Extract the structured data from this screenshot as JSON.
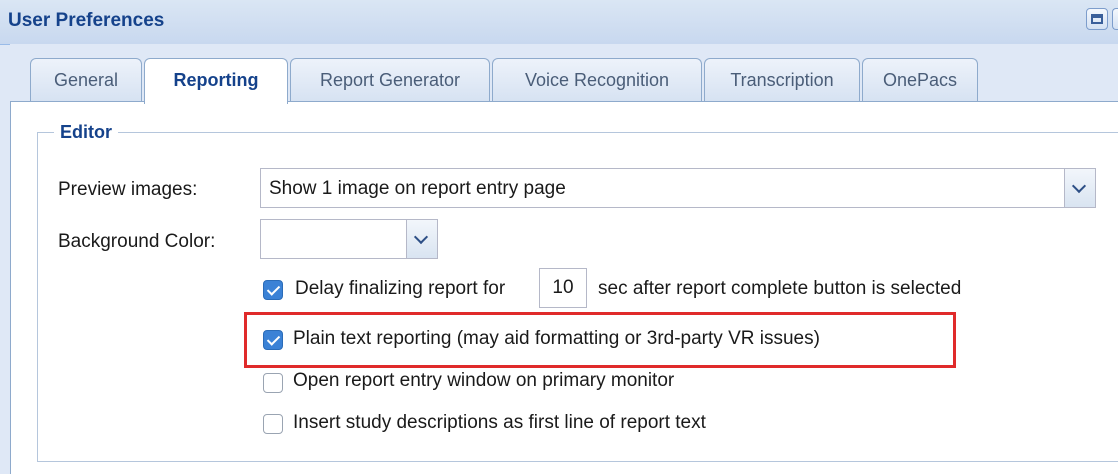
{
  "window": {
    "title": "User Preferences"
  },
  "tabs": [
    {
      "label": "General",
      "active": false
    },
    {
      "label": "Reporting",
      "active": true
    },
    {
      "label": "Report Generator",
      "active": false
    },
    {
      "label": "Voice Recognition",
      "active": false
    },
    {
      "label": "Transcription",
      "active": false
    },
    {
      "label": "OnePacs",
      "active": false
    }
  ],
  "editor": {
    "legend": "Editor",
    "preview_images": {
      "label": "Preview images:",
      "value": "Show 1 image on report entry page",
      "icon": "chevron-down-icon"
    },
    "background_color": {
      "label": "Background Color:",
      "value": "",
      "icon": "chevron-down-icon"
    },
    "delay": {
      "checked": true,
      "label_before": "Delay finalizing report for",
      "seconds": "10",
      "label_after": "sec after report complete button is selected"
    },
    "plain_text": {
      "checked": true,
      "label": "Plain text reporting (may aid formatting or 3rd-party VR issues)",
      "highlight_color": "#e02a2a"
    },
    "primary_monitor": {
      "checked": false,
      "label": "Open report entry window on primary monitor"
    },
    "insert_descriptions": {
      "checked": false,
      "label": "Insert study descriptions as first line of report text"
    }
  },
  "colors": {
    "accent": "#15428b",
    "checkbox_on": "#3b82d6",
    "panel_bg": "#dfe8f6"
  }
}
